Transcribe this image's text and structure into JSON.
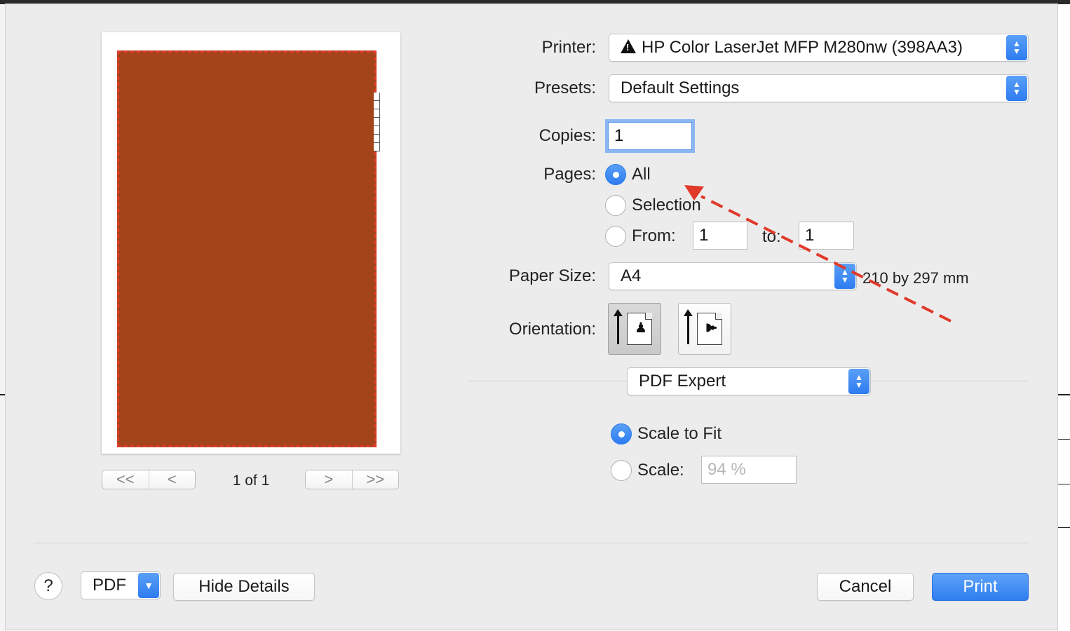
{
  "dialog": {
    "printer_label": "Printer:",
    "printer_value": "HP Color LaserJet MFP M280nw (398AA3)",
    "presets_label": "Presets:",
    "presets_value": "Default Settings",
    "copies_label": "Copies:",
    "copies_value": "1",
    "pages_label": "Pages:",
    "pages_all": "All",
    "pages_selection": "Selection",
    "pages_from": "From:",
    "pages_from_value": "1",
    "pages_to": "to:",
    "pages_to_value": "1",
    "paper_size_label": "Paper Size:",
    "paper_size_value": "A4",
    "paper_size_dims": "210 by 297 mm",
    "orientation_label": "Orientation:",
    "app_menu_value": "PDF Expert",
    "scale_to_fit": "Scale to Fit",
    "scale_label": "Scale:",
    "scale_value": "94 %"
  },
  "preview": {
    "page_indicator": "1 of 1",
    "first_glyph": "<<",
    "prev_glyph": "<",
    "next_glyph": ">",
    "last_glyph": ">>",
    "fill_color": "#a4441b",
    "border_color": "#e03a2a"
  },
  "footer": {
    "help": "?",
    "pdf": "PDF",
    "hide_details": "Hide Details",
    "cancel": "Cancel",
    "print": "Print"
  },
  "state": {
    "pages_selected": "All",
    "scale_selected": "Scale to Fit",
    "orientation_selected": "portrait"
  },
  "colors": {
    "accent": "#2d7cf0",
    "sheet_bg": "#ececec",
    "annotation": "#e03a2a"
  }
}
